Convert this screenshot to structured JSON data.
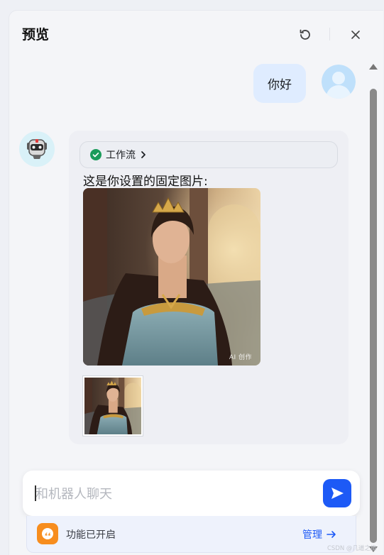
{
  "header": {
    "title": "预览",
    "refresh_icon": "refresh-icon",
    "close_icon": "close-icon"
  },
  "conversation": {
    "user_message": "你好",
    "bot_message": {
      "workflow_label": "工作流",
      "workflow_status": "success",
      "text": "这是你设置的固定图片:",
      "image_watermark": "AI 创作"
    }
  },
  "input": {
    "placeholder": "和机器人聊天",
    "value": ""
  },
  "feature_bar": {
    "status": "功能已开启",
    "manage_label": "管理"
  },
  "footer_watermark": "CSDN @几道之旅",
  "colors": {
    "accent": "#1d5af6",
    "feature_icon": "#f78d1e",
    "success": "#1a9b5a"
  }
}
